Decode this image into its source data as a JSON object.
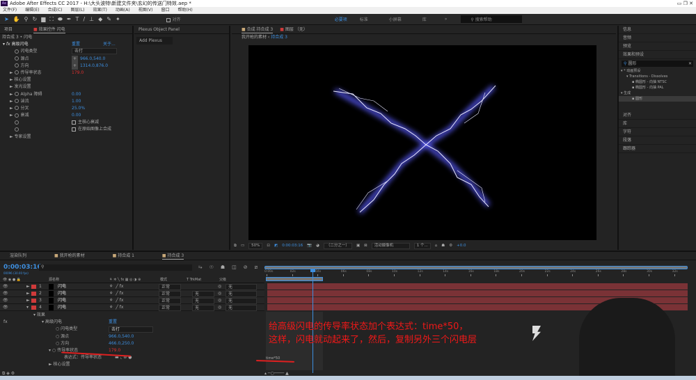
{
  "title": "Adobe After Effects CC 2017 - H:\\大头波特\\新建文件夹\\玄幻的传送门特效.aep *",
  "app_icon": "Ae",
  "menu": [
    "文件(F)",
    "编辑(E)",
    "合成(C)",
    "图层(L)",
    "效果(T)",
    "动画(A)",
    "视图(V)",
    "窗口",
    "帮助(H)"
  ],
  "toolbar": {
    "snap_label": "对齐",
    "workspaces": [
      "必要项",
      "标准",
      "小屏幕",
      "库"
    ],
    "active_workspace": "必要项",
    "search_placeholder": "搜索帮助"
  },
  "effect_controls": {
    "tabs": [
      "项目",
      "效果控件 闪电"
    ],
    "breadcrumb": "持合成 3 • 闪电",
    "effect_name": "高级闪电",
    "reset": "重置",
    "about": "关于...",
    "props": [
      {
        "name": "闪电类型",
        "value": "击打",
        "kind": "select"
      },
      {
        "name": "源点",
        "value": "966.0,540.0",
        "kind": "point"
      },
      {
        "name": "方向",
        "value": "1314.0,876.0",
        "kind": "point"
      },
      {
        "name": "传导率状态",
        "value": "179.0",
        "kind": "red",
        "expand": true
      },
      {
        "name": "核心设置",
        "kind": "group"
      },
      {
        "name": "发光设置",
        "kind": "group"
      },
      {
        "name": "Alpha 障碍",
        "value": "0.00",
        "kind": "num",
        "expand": true
      },
      {
        "name": "湍流",
        "value": "1.00",
        "kind": "num",
        "expand": true
      },
      {
        "name": "分叉",
        "value": "25.0%",
        "kind": "num",
        "expand": true
      },
      {
        "name": "衰减",
        "value": "0.00",
        "kind": "num",
        "expand": true
      },
      {
        "name": "",
        "value": "主核心衰减",
        "kind": "check"
      },
      {
        "name": "",
        "value": "在原始图像上合成",
        "kind": "check"
      },
      {
        "name": "专家设置",
        "kind": "group"
      }
    ]
  },
  "plexus": {
    "tab": "Plexus Object Panel",
    "button": "Add Plexus"
  },
  "composition": {
    "tabs": [
      "合成 持合成 3",
      "图层 （无）"
    ],
    "breadcrumb": [
      "我开枪的素材",
      "持合成 3"
    ],
    "zoom": "50%",
    "timecode": "0:00:03:16",
    "resolution": "（二分之一）",
    "camera": "活动摄像机",
    "views": "1 个...",
    "exposure": "+0.0"
  },
  "right_panels": [
    "信息",
    "音频",
    "预览",
    "效果和预设",
    "对齐",
    "库",
    "字符",
    "段落",
    "跟踪器"
  ],
  "effects_presets": {
    "search": "圆形",
    "tree": [
      {
        "label": "* 动画预设",
        "level": 0
      },
      {
        "label": "Transitions - Dissolves",
        "level": 1
      },
      {
        "label": "椭圆形 - 向抽 NTSC",
        "level": 2
      },
      {
        "label": "椭圆形 - 向抽 PAL",
        "level": 2
      },
      {
        "label": "生成",
        "level": 0
      },
      {
        "label": "圆形",
        "level": 2,
        "selected": true
      }
    ]
  },
  "timeline": {
    "tabs": [
      "渲染队列",
      "我开枪的素材",
      "持合成 1",
      "持合成 3"
    ],
    "timecode": "0:00:03:16",
    "fps": "00096 (30.00 fps)",
    "columns": [
      "源名称",
      "模式",
      "T TrkMat",
      "父级"
    ],
    "layers": [
      {
        "num": "1",
        "name": "闪电",
        "mode": "正常",
        "trkmat": "",
        "parent": "无"
      },
      {
        "num": "2",
        "name": "闪电",
        "mode": "正常",
        "trkmat": "无",
        "parent": "无"
      },
      {
        "num": "3",
        "name": "闪电",
        "mode": "正常",
        "trkmat": "无",
        "parent": "无"
      },
      {
        "num": "4",
        "name": "闪电",
        "mode": "正常",
        "trkmat": "无",
        "parent": "无"
      }
    ],
    "props": {
      "effects": "效果",
      "effect": "高级闪电",
      "reset": "重置",
      "type_label": "闪电类型",
      "type_value": "击打",
      "origin_label": "源点",
      "origin_value": "966.0,540.0",
      "dir_label": "方向",
      "dir_value": "466.0,250.0",
      "cond_label": "传导率状态",
      "cond_value": "179.0",
      "expr_label": "表达式：传导率状态",
      "expression": "time*50",
      "core": "核心设置"
    },
    "ruler": [
      "0:00s",
      "02s",
      "04s",
      "06s",
      "08s",
      "10s",
      "12s",
      "14s",
      "16s",
      "18s",
      "20s",
      "22s",
      "24s",
      "26s",
      "28s",
      "30s",
      "32s"
    ]
  },
  "annotation": [
    "给高级闪电的传导率状态加个表达式：time*50，",
    "这样，闪电就动起来了，然后，复制另外三个闪电层"
  ],
  "colors": {
    "accent": "#3d8fe0",
    "label_red": "#d03a3a",
    "layer_bar": "#7a3236",
    "lightning": "#6a6cff",
    "note": "#f01818"
  }
}
